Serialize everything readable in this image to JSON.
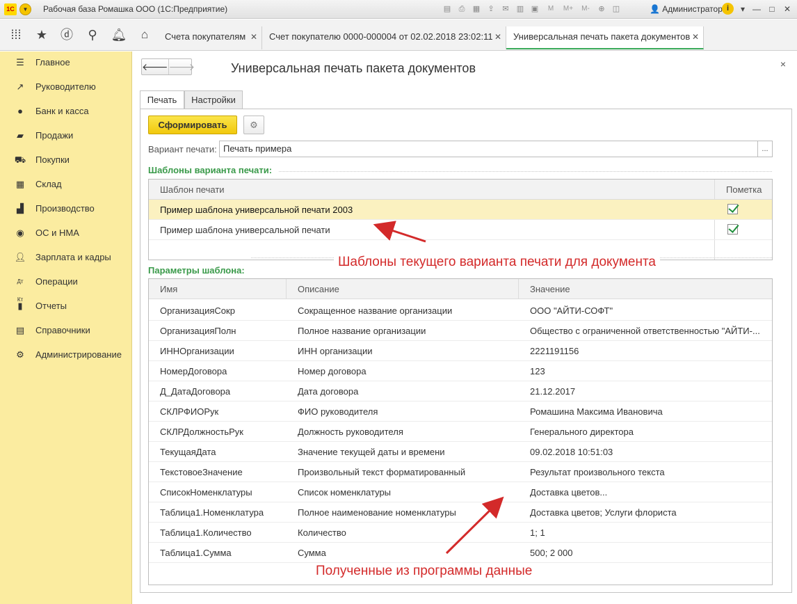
{
  "window": {
    "app_logo": "1С",
    "title": "Рабочая база Ромашка ООО  (1С:Предприятие)",
    "user": "Администратор",
    "toolbar_m_buttons": [
      "M",
      "M+",
      "M-"
    ]
  },
  "nav_icons": [
    "apps-grid-icon",
    "star-icon",
    "history-icon",
    "search-icon",
    "bell-icon",
    "home-icon"
  ],
  "tabs": [
    {
      "label": "Счета покупателям",
      "close": "✕"
    },
    {
      "label": "Счет покупателю 0000-000004 от 02.02.2018 23:02:11",
      "close": "✕"
    },
    {
      "label": "Универсальная печать пакета документов",
      "close": "✕"
    }
  ],
  "sidebar": {
    "items": [
      {
        "label": "Главное",
        "icon": "menu-lines-icon"
      },
      {
        "label": "Руководителю",
        "icon": "trend-up-icon"
      },
      {
        "label": "Банк и касса",
        "icon": "ruble-coin-icon"
      },
      {
        "label": "Продажи",
        "icon": "shopping-bag-icon"
      },
      {
        "label": "Покупки",
        "icon": "shopping-cart-icon"
      },
      {
        "label": "Склад",
        "icon": "warehouse-grid-icon"
      },
      {
        "label": "Производство",
        "icon": "factory-icon"
      },
      {
        "label": "ОС и НМА",
        "icon": "car-icon"
      },
      {
        "label": "Зарплата и кадры",
        "icon": "person-icon"
      },
      {
        "label": "Операции",
        "icon": "dt-kt-icon"
      },
      {
        "label": "Отчеты",
        "icon": "bar-chart-icon"
      },
      {
        "label": "Справочники",
        "icon": "book-icon"
      },
      {
        "label": "Администрирование",
        "icon": "gear-icon"
      }
    ]
  },
  "form": {
    "title": "Универсальная печать пакета документов",
    "back_glyph": "🡐",
    "forward_glyph": "🡒",
    "close_glyph": "×",
    "tabs": [
      "Печать",
      "Настройки"
    ],
    "generate_button": "Сформировать",
    "variant_label": "Вариант печати:",
    "variant_value": "Печать примера",
    "variant_select": "...",
    "templates_section": "Шаблоны варианта печати:",
    "templates_columns": [
      "Шаблон печати",
      "Пометка"
    ],
    "templates": [
      {
        "name": "Пример шаблона универсальной печати 2003",
        "checked": true
      },
      {
        "name": "Пример шаблона универсальной печати",
        "checked": true
      }
    ],
    "params_section": "Параметры шаблона:",
    "params_columns": [
      "Имя",
      "Описание",
      "Значение"
    ],
    "params": [
      {
        "name": "ОрганизацияСокр",
        "desc": "Сокращенное название организации",
        "value": "ООО \"АЙТИ-СОФТ\""
      },
      {
        "name": "ОрганизацияПолн",
        "desc": "Полное название организации",
        "value": "Общество с ограниченной ответственностью \"АЙТИ-..."
      },
      {
        "name": "ИННОрганизации",
        "desc": "ИНН организации",
        "value": "2221191156"
      },
      {
        "name": "НомерДоговора",
        "desc": "Номер договора",
        "value": "123"
      },
      {
        "name": "Д_ДатаДоговора",
        "desc": "Дата договора",
        "value": "21.12.2017"
      },
      {
        "name": "СКЛРФИОРук",
        "desc": "ФИО руководителя",
        "value": "Ромашина Максима Ивановича"
      },
      {
        "name": "СКЛРДолжностьРук",
        "desc": "Должность руководителя",
        "value": "Генерального директора"
      },
      {
        "name": "ТекущаяДата",
        "desc": "Значение текущей даты и времени",
        "value": "09.02.2018 10:51:03"
      },
      {
        "name": "ТекстовоеЗначение",
        "desc": "Произвольный текст форматированный",
        "value": "Результат произвольного текста"
      },
      {
        "name": "СписокНоменклатуры",
        "desc": "Список номенклатуры",
        "value": "Доставка цветов..."
      },
      {
        "name": "Таблица1.Номенклатура",
        "desc": "Полное наименование номенклатуры",
        "value": "Доставка цветов; Услуги флориста"
      },
      {
        "name": "Таблица1.Количество",
        "desc": "Количество",
        "value": "1; 1"
      },
      {
        "name": "Таблица1.Сумма",
        "desc": "Сумма",
        "value": "500; 2 000"
      }
    ]
  },
  "annotations": {
    "templates_note": "Шаблоны текущего варианта печати для документа",
    "data_note": "Полученные из программы данные",
    "color": "#d32a2a"
  }
}
